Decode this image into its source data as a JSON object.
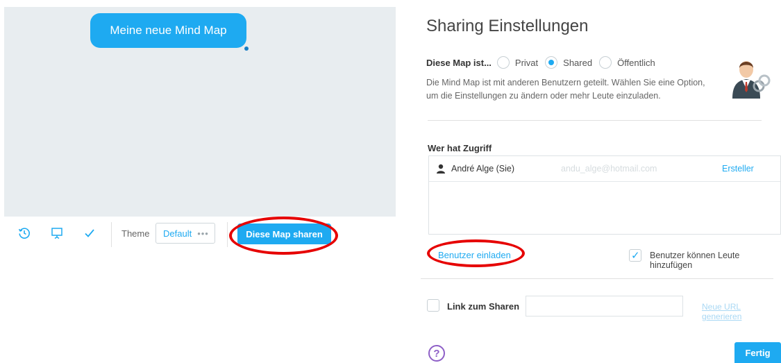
{
  "mindmap": {
    "node_text": "Meine neue Mind Map"
  },
  "toolbar": {
    "icons": [
      "history-icon",
      "presentation-icon",
      "check-icon"
    ],
    "theme_label": "Theme",
    "theme_value": "Default",
    "theme_more": "•••",
    "share_button": "Diese Map sharen"
  },
  "dialog": {
    "title": "Sharing Einstellungen",
    "privacy": {
      "label": "Diese Map ist...",
      "options": [
        "Privat",
        "Shared",
        "Öffentlich"
      ],
      "selected": "Shared"
    },
    "description": "Die Mind Map ist mit anderen Benutzern geteilt. Wählen Sie eine Option, um die Einstellungen zu ändern oder mehr Leute einzuladen.",
    "access": {
      "title": "Wer hat Zugriff",
      "users": [
        {
          "name": "André Alge (Sie)",
          "email": "andu_alge@hotmail.com",
          "role": "Ersteller"
        }
      ]
    },
    "invite_link": "Benutzer einladen",
    "allow_add_people": {
      "label": "Benutzer können Leute hinzufügen",
      "checked": true
    },
    "share_link": {
      "label": "Link zum Sharen",
      "checked": false,
      "value": "",
      "generate_label": "Neue URL generieren"
    },
    "help_symbol": "?",
    "done_button": "Fertig"
  },
  "colors": {
    "accent": "#1eaaf1",
    "annotation": "#e60000",
    "help": "#8e5fc7"
  }
}
